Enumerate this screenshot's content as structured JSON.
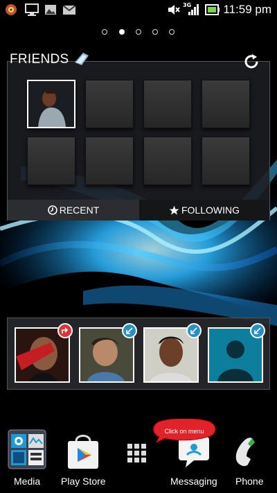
{
  "status_bar": {
    "time": "11:59 pm",
    "network_type": "3G",
    "icons": [
      "browser-notification-icon",
      "monitor-icon",
      "image-icon",
      "gmail-icon",
      "mute-icon",
      "network-3g-icon",
      "signal-icon",
      "battery-icon"
    ]
  },
  "home_screen": {
    "page_count": 5,
    "active_page": 2
  },
  "friends_widget": {
    "title": "FRIENDS",
    "tabs": [
      {
        "label": "RECENT",
        "icon": "clock-icon"
      },
      {
        "label": "FOLLOWING",
        "icon": "star-icon"
      }
    ],
    "selected_tab": "FOLLOWING"
  },
  "contacts_strip": {
    "badges": [
      "share-icon",
      "arrow-icon",
      "arrow-icon",
      "arrow-icon"
    ]
  },
  "dock": {
    "items": [
      {
        "label": "Media",
        "icon": "media-folder-icon"
      },
      {
        "label": "Play Store",
        "icon": "play-store-icon"
      },
      {
        "label": "",
        "icon": "apps-menu-icon"
      },
      {
        "label": "Messaging",
        "icon": "messaging-icon"
      },
      {
        "label": "Phone",
        "icon": "phone-icon"
      }
    ]
  },
  "annotation": {
    "text": "Click on menu"
  },
  "colors": {
    "wallpaper_blue": "#19b6ff",
    "badge_red": "#d9363a",
    "badge_blue": "#2a8fc4",
    "callout_red": "#e0232b"
  }
}
